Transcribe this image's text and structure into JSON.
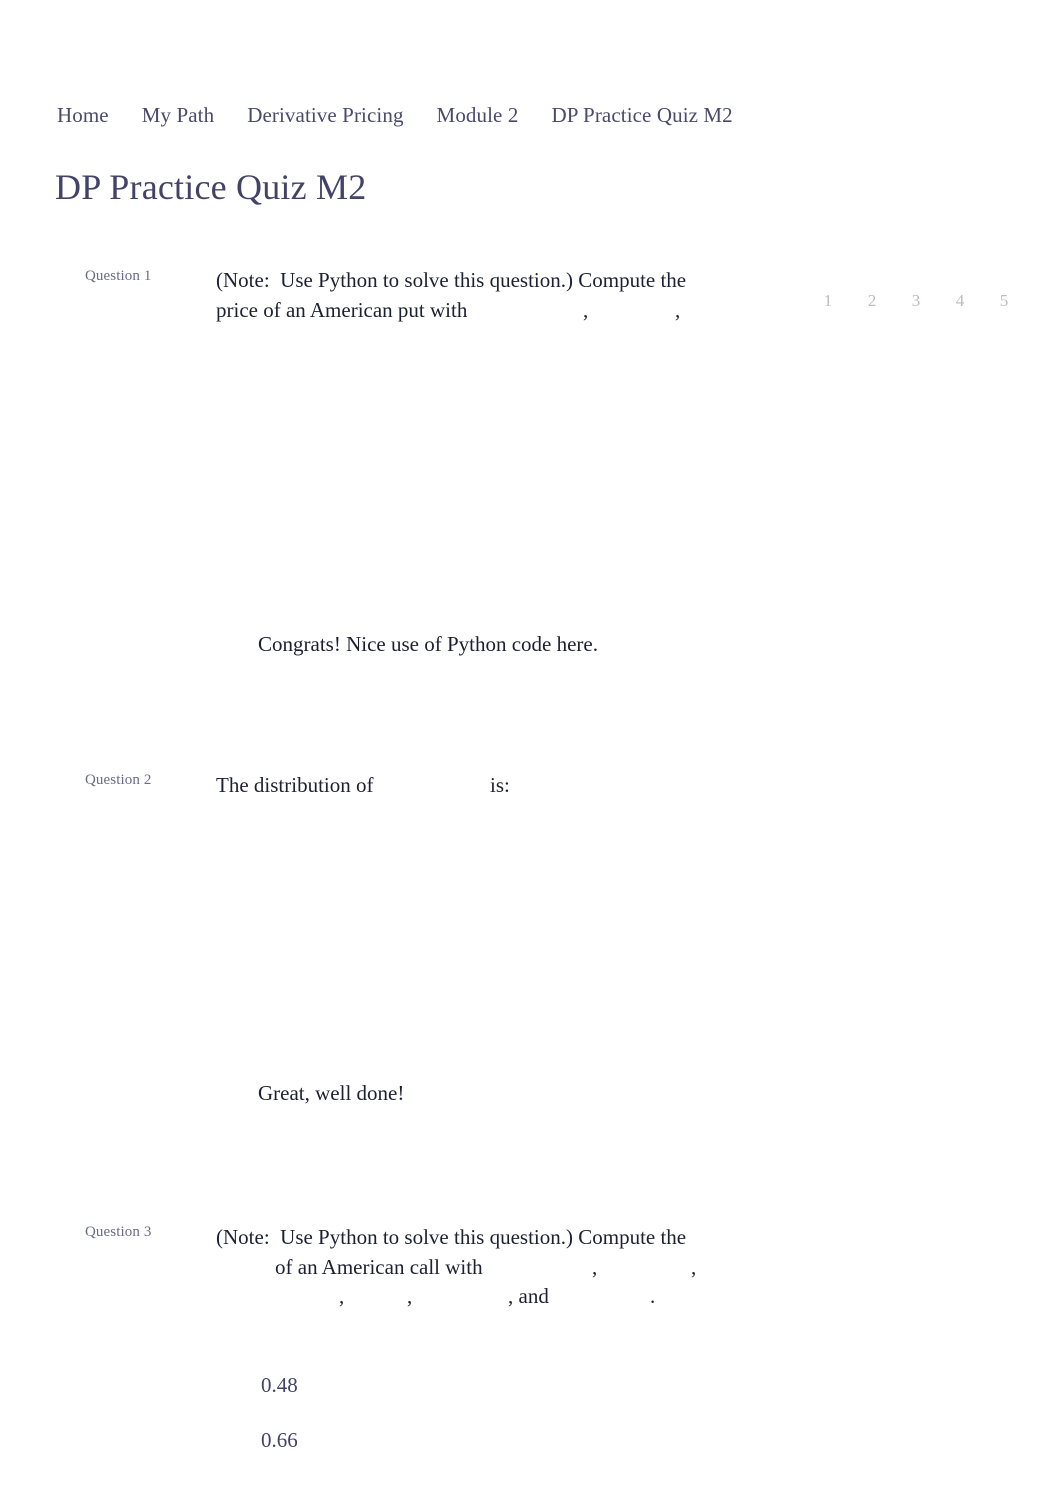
{
  "breadcrumb": {
    "items": [
      {
        "label": "Home"
      },
      {
        "label": "My Path"
      },
      {
        "label": "Derivative Pricing"
      },
      {
        "label": "Module 2"
      },
      {
        "label": "DP Practice Quiz M2"
      }
    ]
  },
  "page": {
    "title": "DP Practice Quiz M2",
    "title_color": "#43436a",
    "body_color": "#1c2033",
    "muted_color": "#6b6b88",
    "pagination_color": "#bcbcc4",
    "background": "#ffffff"
  },
  "pagination": {
    "pages": [
      "1",
      "2",
      "3",
      "4",
      "5"
    ]
  },
  "questions": [
    {
      "label": "Question 1",
      "lines": [
        "(Note:  Use Python to solve this question.) Compute the",
        "price of an American put with"
      ],
      "trailing_punctuation": [
        ",",
        ","
      ],
      "feedback": "Congrats! Nice use of Python code here.",
      "options": []
    },
    {
      "label": "Question 2",
      "lines": [
        "The distribution of"
      ],
      "line_suffix": "is:",
      "feedback": "Great, well done!",
      "options": []
    },
    {
      "label": "Question 3",
      "lines": [
        "(Note:  Use Python to solve this question.) Compute the",
        "of an American call with",
        ""
      ],
      "line3_words": ", and",
      "line3_period": ".",
      "feedback": "",
      "options": [
        {
          "value": "0.48"
        },
        {
          "value": "0.66"
        }
      ]
    }
  ]
}
